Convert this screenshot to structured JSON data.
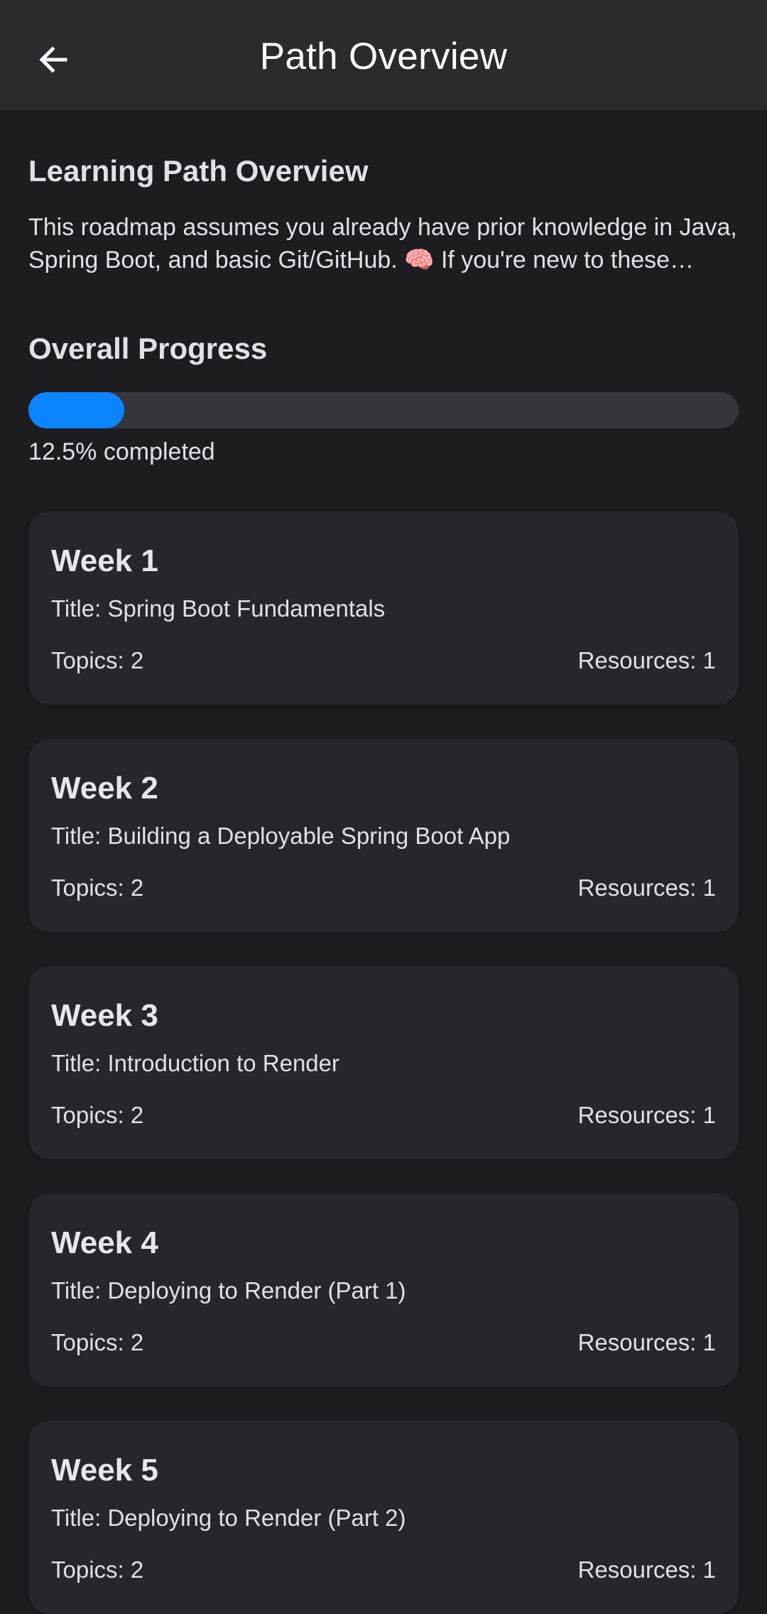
{
  "app_bar": {
    "title": "Path Overview",
    "back_icon": "arrow-left-icon"
  },
  "overview": {
    "heading": "Learning Path Overview",
    "description": "This roadmap assumes you already have prior knowledge in Java, Spring Boot, and basic Git/GitHub. 🧠 If you're new to these technologies, consider reviewing the basics first."
  },
  "progress": {
    "heading": "Overall Progress",
    "percent": 12.5,
    "label": "12.5% completed",
    "fill_color": "#0a84ff"
  },
  "weeks": [
    {
      "week": "Week 1",
      "title": "Title: Spring Boot Fundamentals",
      "topics": "Topics: 2",
      "resources": "Resources: 1"
    },
    {
      "week": "Week 2",
      "title": "Title: Building a Deployable Spring Boot App",
      "topics": "Topics: 2",
      "resources": "Resources: 1"
    },
    {
      "week": "Week 3",
      "title": "Title: Introduction to Render",
      "topics": "Topics: 2",
      "resources": "Resources: 1"
    },
    {
      "week": "Week 4",
      "title": "Title: Deploying to Render (Part 1)",
      "topics": "Topics: 2",
      "resources": "Resources: 1"
    },
    {
      "week": "Week 5",
      "title": "Title: Deploying to Render (Part 2)",
      "topics": "Topics: 2",
      "resources": "Resources: 1"
    }
  ]
}
